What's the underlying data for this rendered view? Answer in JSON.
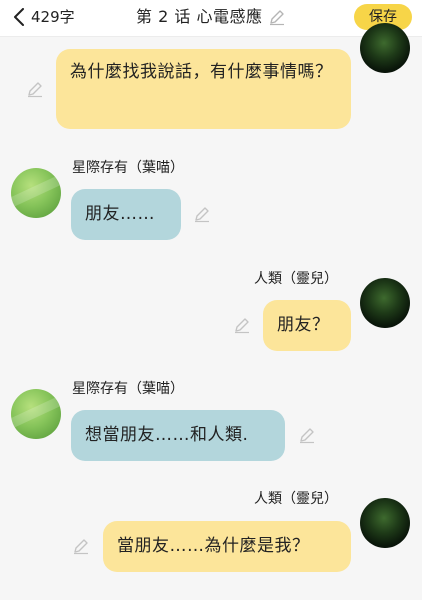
{
  "header": {
    "word_count": "429字",
    "title": "第 2 话 心電感應",
    "save_label": "保存"
  },
  "messages": [
    {
      "speaker": "",
      "side": "right",
      "text": "為什麼找我說話，有什麼事情嗎？"
    },
    {
      "speaker": "星際存有（葉喵）",
      "side": "left",
      "text": "朋友……"
    },
    {
      "speaker": "人類（靈兒）",
      "side": "right",
      "text": "朋友？"
    },
    {
      "speaker": "星際存有（葉喵）",
      "side": "left",
      "text": "想當朋友……和人類."
    },
    {
      "speaker": "人類（靈兒）",
      "side": "right",
      "text": "當朋友……為什麼是我？"
    }
  ],
  "colors": {
    "save_button": "#f7d548",
    "right_bubble": "#fce59a",
    "left_bubble": "#b3d6dc"
  }
}
